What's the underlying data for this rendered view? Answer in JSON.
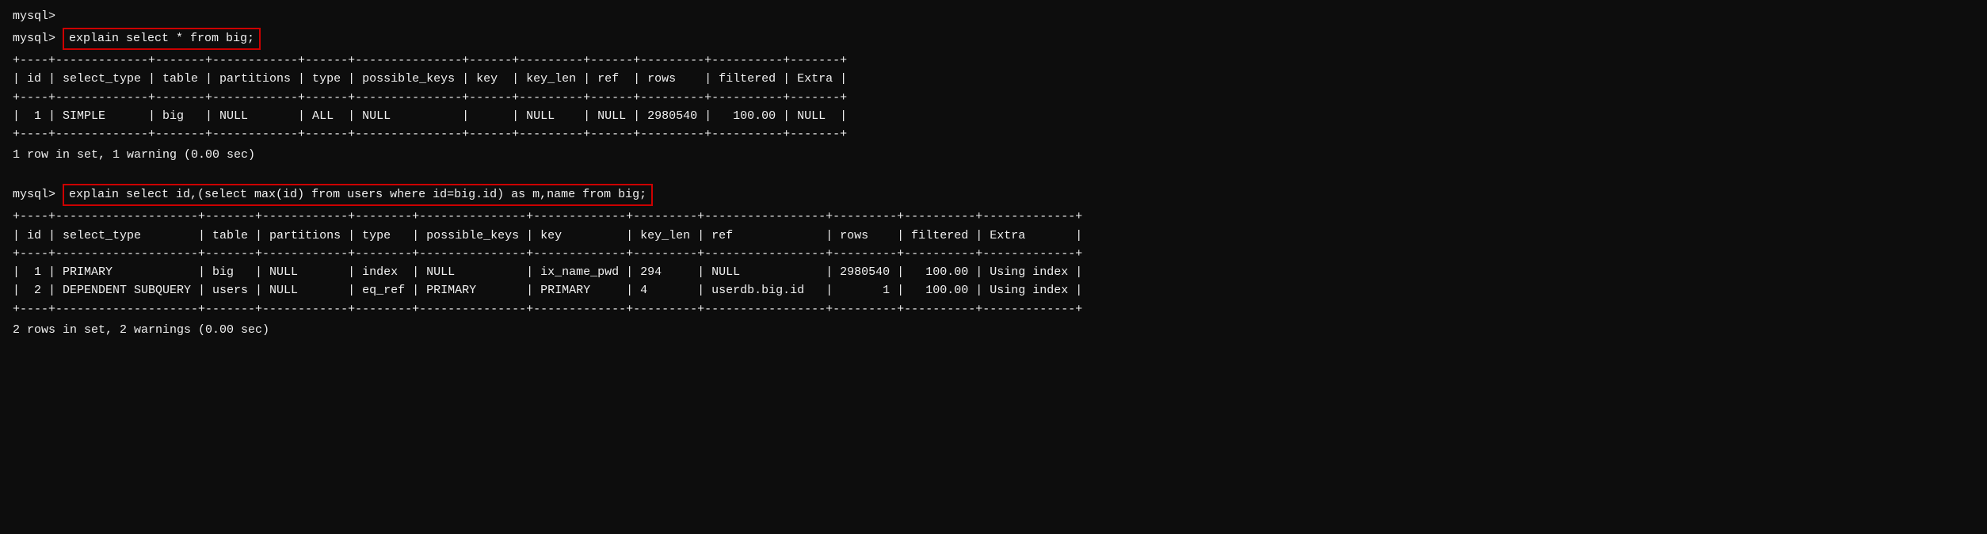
{
  "terminal": {
    "prompt": "mysql>",
    "lines": [
      {
        "type": "prompt-blank",
        "text": "mysql>"
      },
      {
        "type": "prompt-command",
        "prompt": "mysql>",
        "command": "explain select * from big;"
      },
      {
        "type": "table-separator",
        "text": "+----+-------------+-------+------------+------+---------------+------+---------+------+---------+----------+-------+"
      },
      {
        "type": "table-header",
        "text": "| id | select_type | table | partitions | type | possible_keys | key  | key_len | ref  | rows    | filtered | Extra |"
      },
      {
        "type": "table-separator",
        "text": "+----+-------------+-------+------------+------+---------------+------+---------+------+---------+----------+-------+"
      },
      {
        "type": "table-row",
        "text": "|  1 | SIMPLE      | big   | NULL       | ALL  | NULL          |      | NULL    | NULL | 2980540 |   100.00 | NULL  |"
      },
      {
        "type": "table-separator",
        "text": "+----+-------------+-------+------------+------+---------------+------+---------+------+---------+----------+-------+"
      },
      {
        "type": "result",
        "text": "1 row in set, 1 warning (0.00 sec)"
      },
      {
        "type": "blank"
      },
      {
        "type": "prompt-command",
        "prompt": "mysql>",
        "command": "explain select id,(select max(id) from users where id=big.id) as m,name from big;"
      },
      {
        "type": "table-separator-wide",
        "text": "+----+--------------------+-------+------------+--------+---------------+-------------+---------+-----------------+---------+----------+-------------+"
      },
      {
        "type": "table-header-wide",
        "text": "| id | select_type        | table | partitions | type   | possible_keys | key         | key_len | ref             | rows    | filtered | Extra       |"
      },
      {
        "type": "table-separator-wide",
        "text": "+----+--------------------+-------+------------+--------+---------------+-------------+---------+-----------------+---------+----------+-------------+"
      },
      {
        "type": "table-row-wide-1",
        "text": "|  1 | PRIMARY            | big   | NULL       | index  | NULL          | ix_name_pwd | 294     | NULL            | 2980540 |   100.00 | Using index |"
      },
      {
        "type": "table-row-wide-2",
        "text": "|  2 | DEPENDENT SUBQUERY | users | NULL       | eq_ref | PRIMARY       | PRIMARY     | 4       | userdb.big.id   |       1 |   100.00 | Using index |"
      },
      {
        "type": "table-separator-wide",
        "text": "+----+--------------------+-------+------------+--------+---------------+-------------+---------+-----------------+---------+----------+-------------+"
      },
      {
        "type": "result",
        "text": "2 rows in set, 2 warnings (0.00 sec)"
      }
    ],
    "commands": {
      "cmd1": "explain select * from big;",
      "cmd2": "explain select id,(select max(id) from users where id=big.id) as m,name from big;"
    },
    "table1": {
      "separator": "+----+-------------+-------+------------+------+---------------+------+---------+------+---------+----------+-------+",
      "header": "| id | select_type | table | partitions | type | possible_keys | key  | key_len | ref  | rows    | filtered | Extra |",
      "row1": "|  1 | SIMPLE      | big   | NULL       | ALL  | NULL          |      | NULL    | NULL | 2980540 |   100.00 | NULL  |",
      "result": "1 row in set, 1 warning (0.00 sec)"
    },
    "table2": {
      "separator": "+----+--------------------+-------+------------+--------+---------------+-------------+---------+-----------------+---------+----------+-------------+",
      "header": "| id | select_type        | table | partitions | type   | possible_keys | key         | key_len | ref             | rows    | filtered | Extra       |",
      "row1": "|  1 | PRIMARY            | big   | NULL       | index  | NULL          | ix_name_pwd | 294     | NULL            | 2980540 |   100.00 | Using index |",
      "row2": "|  2 | DEPENDENT SUBQUERY | users | NULL       | eq_ref | PRIMARY       | PRIMARY     | 4       | userdb.big.id   |       1 |   100.00 | Using index |",
      "result": "2 rows in set, 2 warnings (0.00 sec)"
    }
  }
}
